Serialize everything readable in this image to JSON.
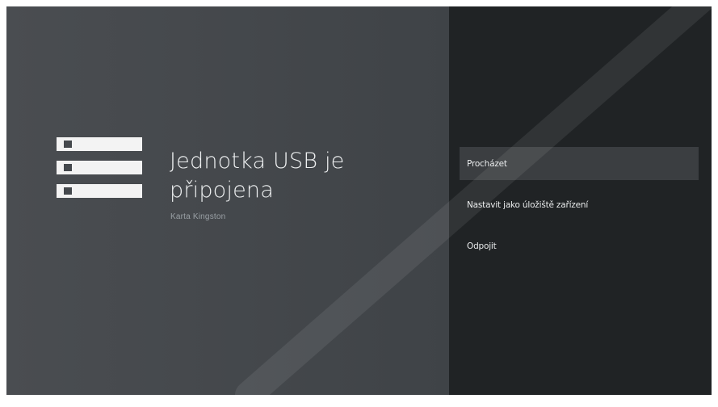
{
  "title": "Jednotka USB je\npřipojena",
  "subtitle": "Karta Kingston",
  "menu": {
    "items": [
      {
        "label": "Procházet"
      },
      {
        "label": "Nastavit jako úložiště zařízení"
      },
      {
        "label": "Odpojit"
      }
    ]
  },
  "icon": "storage-stack-icon",
  "colors": {
    "left_panel": "#45494d",
    "right_panel": "#202325",
    "focused_item": "#3b3e41",
    "text_primary": "#eef0f1",
    "text_secondary": "#9aa0a5"
  }
}
